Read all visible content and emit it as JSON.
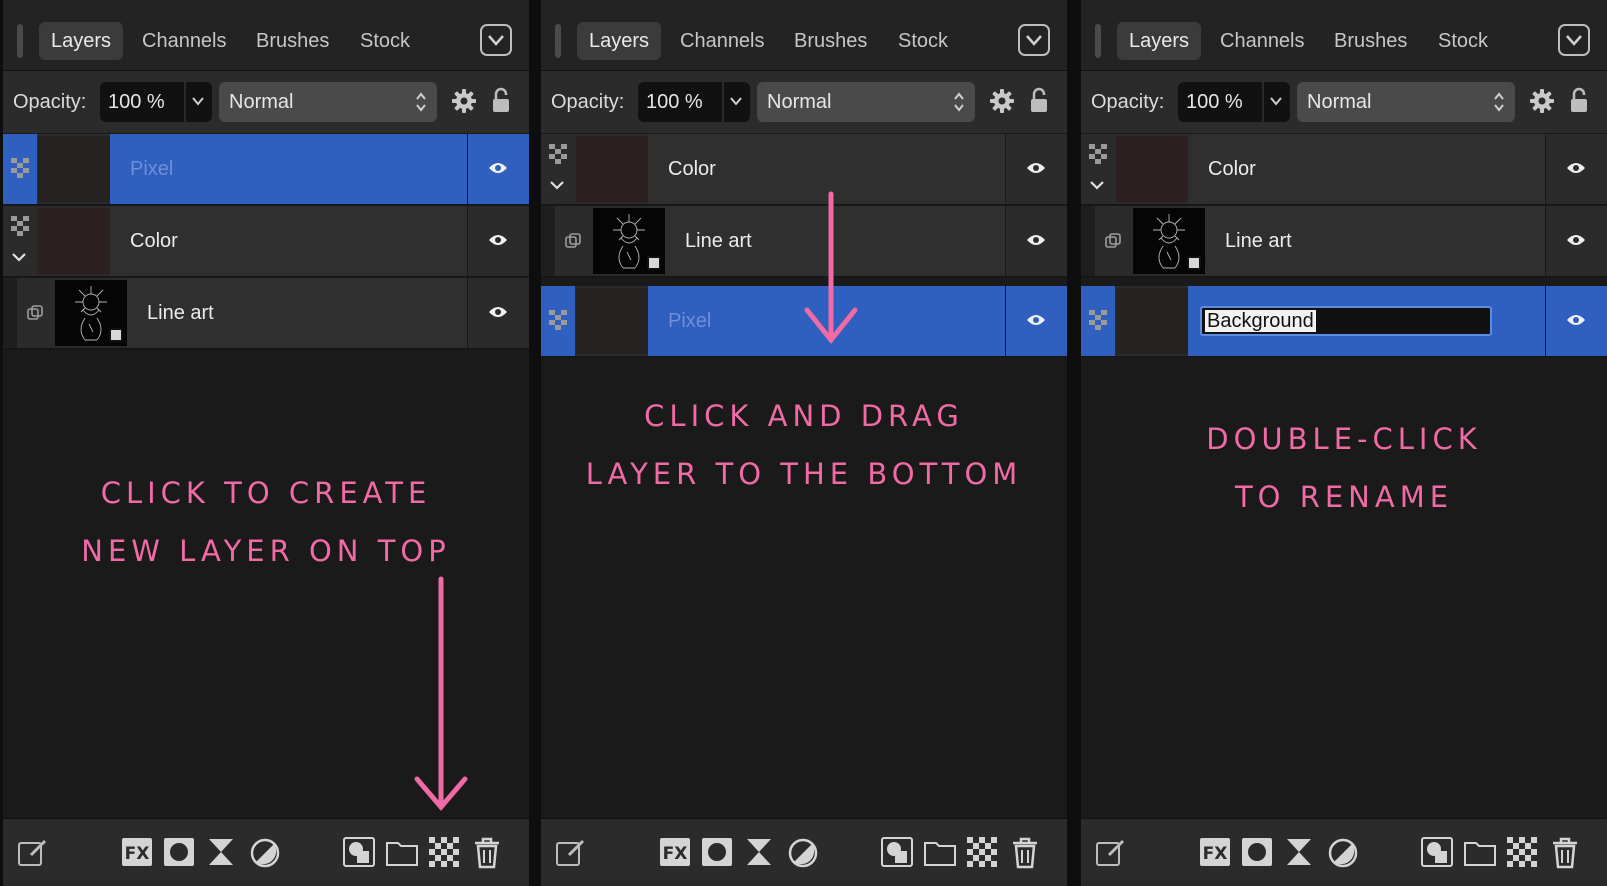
{
  "panels": [
    {
      "tabs": [
        "Layers",
        "Channels",
        "Brushes",
        "Stock"
      ],
      "opacity_label": "Opacity:",
      "opacity_value": "100 %",
      "blend_mode": "Normal",
      "layers": [
        {
          "name": "Pixel",
          "selected": true
        },
        {
          "name": "Color",
          "expanded": true
        },
        {
          "name": "Line art",
          "child": true
        }
      ],
      "note_lines": [
        "Click to create",
        "new layer on top"
      ]
    },
    {
      "tabs": [
        "Layers",
        "Channels",
        "Brushes",
        "Stock"
      ],
      "opacity_label": "Opacity:",
      "opacity_value": "100 %",
      "blend_mode": "Normal",
      "layers": [
        {
          "name": "Color",
          "expanded": true
        },
        {
          "name": "Line art",
          "child": true
        },
        {
          "name": "Pixel",
          "selected": true
        }
      ],
      "note_lines": [
        "Click and drag",
        "layer to the bottom"
      ]
    },
    {
      "tabs": [
        "Layers",
        "Channels",
        "Brushes",
        "Stock"
      ],
      "opacity_label": "Opacity:",
      "opacity_value": "100 %",
      "blend_mode": "Normal",
      "layers": [
        {
          "name": "Color",
          "expanded": true
        },
        {
          "name": "Line art",
          "child": true
        },
        {
          "name": "Background",
          "selected": true,
          "editing": true
        }
      ],
      "note_lines": [
        "Double-click",
        "to rename"
      ]
    }
  ],
  "icons": {
    "panel_menu": "chevron-down-icon",
    "gear": "gear-icon",
    "lock": "lock-icon",
    "visibility": "eye-icon",
    "pixel_layer": "checkerboard-icon",
    "toolbar": [
      "edit-icon",
      "fx-icon",
      "mask-icon",
      "hourglass-icon",
      "adjustment-icon",
      "place-image-icon",
      "folder-icon",
      "new-pixel-layer-icon",
      "trash-icon"
    ]
  },
  "colors": {
    "selection": "#2f5fbf",
    "annotation": "#f06aa6",
    "panel_bg": "#1a1a1a"
  }
}
